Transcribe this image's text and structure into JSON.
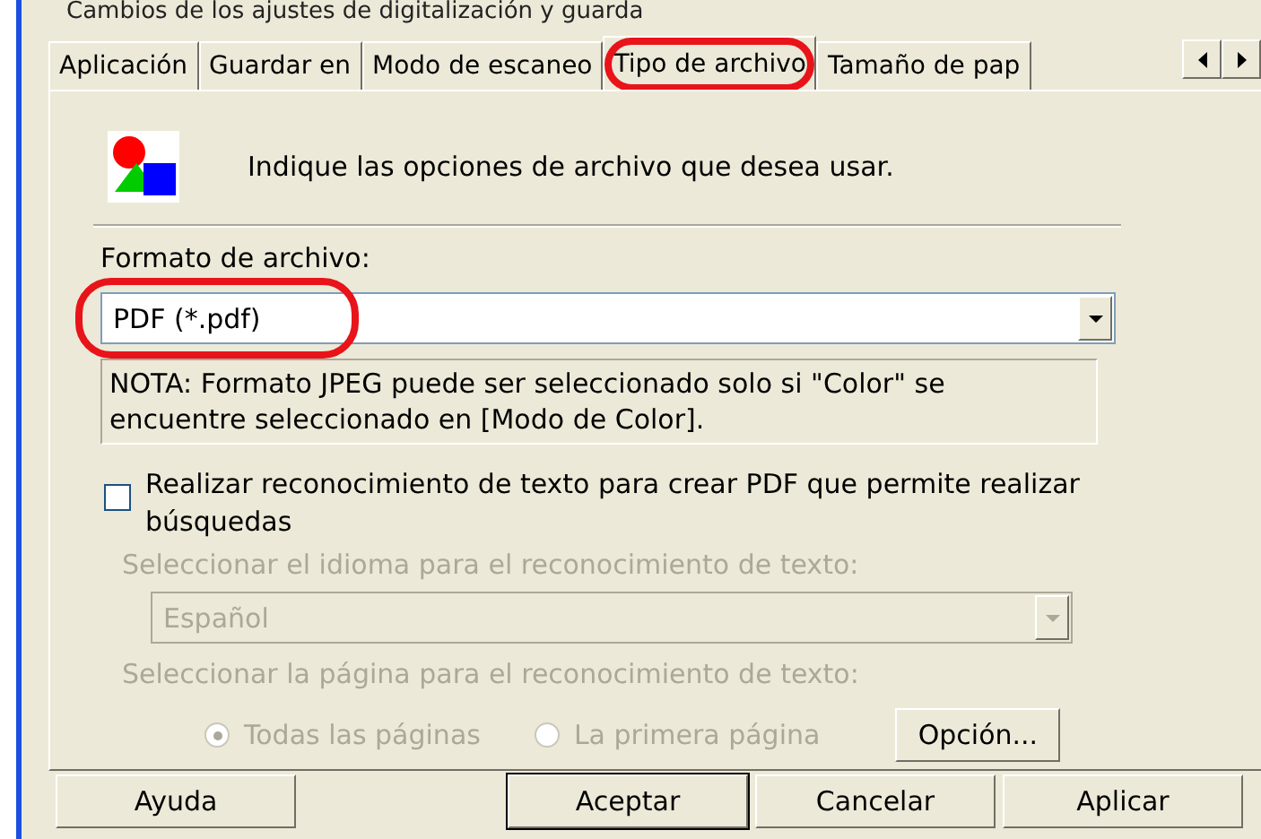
{
  "window": {
    "title": "Cambios de los ajustes de digitalización y guarda"
  },
  "tabs": [
    {
      "label": "Aplicación",
      "selected": false,
      "highlighted": false
    },
    {
      "label": "Guardar en",
      "selected": false,
      "highlighted": false
    },
    {
      "label": "Modo de escaneo",
      "selected": false,
      "highlighted": false
    },
    {
      "label": "Tipo de archivo",
      "selected": true,
      "highlighted": true
    },
    {
      "label": "Tamaño de pap",
      "selected": false,
      "highlighted": false
    }
  ],
  "intro": "Indique las opciones de archivo que desea usar.",
  "format": {
    "label": "Formato de archivo:",
    "value": "PDF (*.pdf)",
    "highlighted": true
  },
  "note": "NOTA: Formato JPEG puede ser seleccionado solo si \"Color\" se encuentre seleccionado en [Modo de Color].",
  "ocr": {
    "label": "Realizar reconocimiento de texto para crear PDF que permite realizar búsquedas",
    "checked": false,
    "language_label": "Seleccionar el idioma para el reconocimiento de texto:",
    "language": "Español",
    "pages_label": "Seleccionar la página para el reconocimiento de texto:",
    "pages": [
      {
        "label": "Todas las páginas",
        "selected": true
      },
      {
        "label": "La primera página",
        "selected": false
      }
    ],
    "option_button": "Opción...",
    "disabled": true
  },
  "buttons": [
    {
      "label": "Ayuda",
      "default": false
    },
    {
      "label": "Aceptar",
      "default": true
    },
    {
      "label": "Cancelar",
      "default": false
    },
    {
      "label": "Aplicar",
      "default": false
    }
  ]
}
